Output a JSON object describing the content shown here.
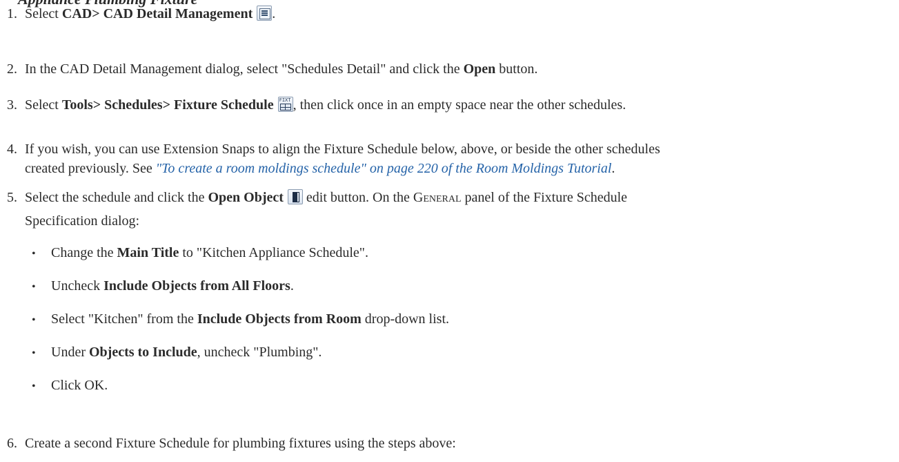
{
  "section_title": "Appliance Plumbing Fixture",
  "steps": [
    {
      "num": "1.",
      "pre": "Select ",
      "bold": "CAD> CAD Detail Management",
      "icon": "cad-detail-management-icon",
      "post": "."
    },
    {
      "num": "2.",
      "pre": "In the CAD Detail Management dialog, select \"Schedules Detail\" and click the ",
      "bold": "Open",
      "post": " button."
    },
    {
      "num": "3.",
      "pre": "Select ",
      "bold": "Tools> Schedules> Fixture Schedule",
      "icon": "fixture-schedule-icon",
      "post": ", then click once in an empty space near the other schedules."
    },
    {
      "num": "4.",
      "line1": "If you wish, you can use Extension Snaps to align the Fixture Schedule below, above, or beside the other schedules",
      "line2_pre": "created previously. See ",
      "link": "\"To create a room moldings schedule\" on page 220 of the Room Moldings Tutorial",
      "line2_post": "."
    },
    {
      "num": "5.",
      "pre": "Select the schedule and click the ",
      "bold": "Open Object",
      "icon": "open-object-icon",
      "mid": " edit button. On the ",
      "smallcaps": "General",
      "post": " panel of the Fixture Schedule",
      "line2": "Specification dialog:"
    },
    {
      "num": "6.",
      "text": "Create a second Fixture Schedule for plumbing fixtures using the steps above:"
    }
  ],
  "bullets": [
    {
      "pre": "Change the ",
      "bold": "Main Title",
      "post": " to \"Kitchen Appliance Schedule\"."
    },
    {
      "pre": "Uncheck ",
      "bold": "Include Objects from All Floors",
      "post": "."
    },
    {
      "pre": "Select \"Kitchen\" from the ",
      "bold": "Include Objects from Room",
      "post": " drop-down list."
    },
    {
      "pre": "Under ",
      "bold": "Objects to Include",
      "post": ", uncheck \"Plumbing\"."
    },
    {
      "pre": "Click OK.",
      "bold": "",
      "post": ""
    }
  ],
  "bullet_char": "•",
  "colors": {
    "text": "#2b2b2b",
    "link": "#2563a8"
  }
}
